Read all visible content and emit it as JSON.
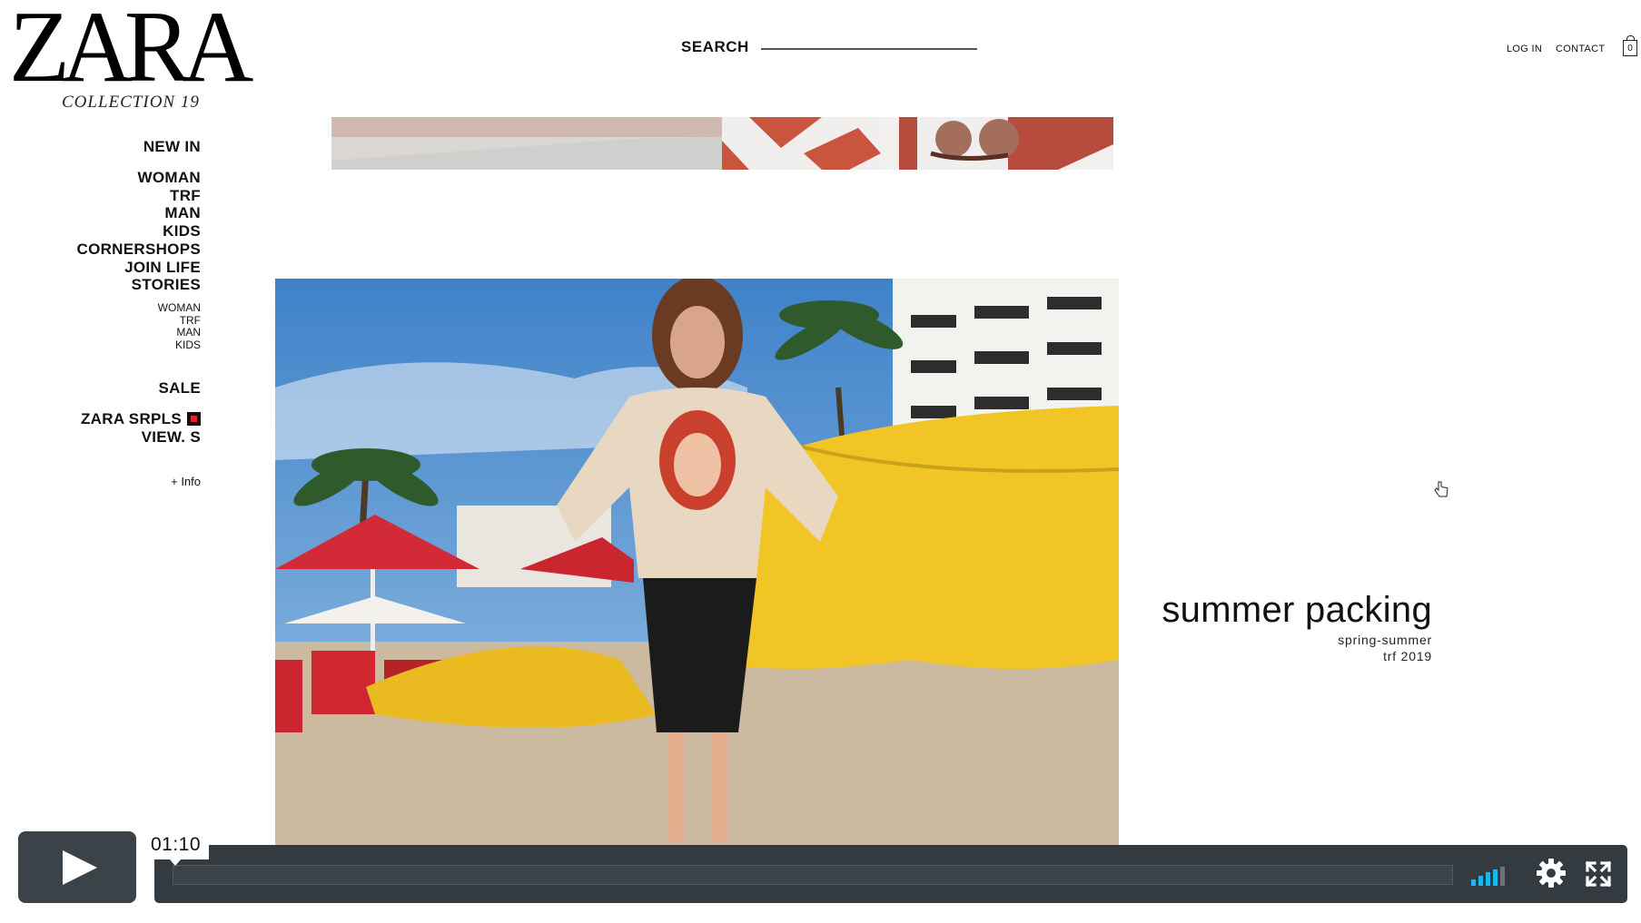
{
  "brand": {
    "logo": "ZARA",
    "collection": "COLLECTION 19"
  },
  "search": {
    "label": "SEARCH",
    "placeholder": ""
  },
  "header": {
    "login": "LOG IN",
    "contact": "CONTACT",
    "bag_count": "0"
  },
  "nav": {
    "new_in": "NEW IN",
    "main": [
      "WOMAN",
      "TRF",
      "MAN",
      "KIDS",
      "CORNERSHOPS",
      "JOIN LIFE",
      "STORIES"
    ],
    "stories_sub": [
      "WOMAN",
      "TRF",
      "MAN",
      "KIDS"
    ],
    "sale": "SALE",
    "srpls": "ZARA SRPLS",
    "views": "VIEW. S",
    "info": "+ Info"
  },
  "campaign": {
    "title": "summer packing",
    "season": "spring-summer",
    "line": "trf 2019"
  },
  "player": {
    "time": "01:10",
    "progress": 0
  },
  "colors": {
    "player_bg": "#333b41",
    "volume_active": "#1ab7ea",
    "accent_red": "#e02424"
  },
  "icons": {
    "play": "play-icon",
    "volume": "volume-icon",
    "settings": "gear-icon",
    "fullscreen": "fullscreen-icon",
    "bag": "shopping-bag-icon"
  }
}
